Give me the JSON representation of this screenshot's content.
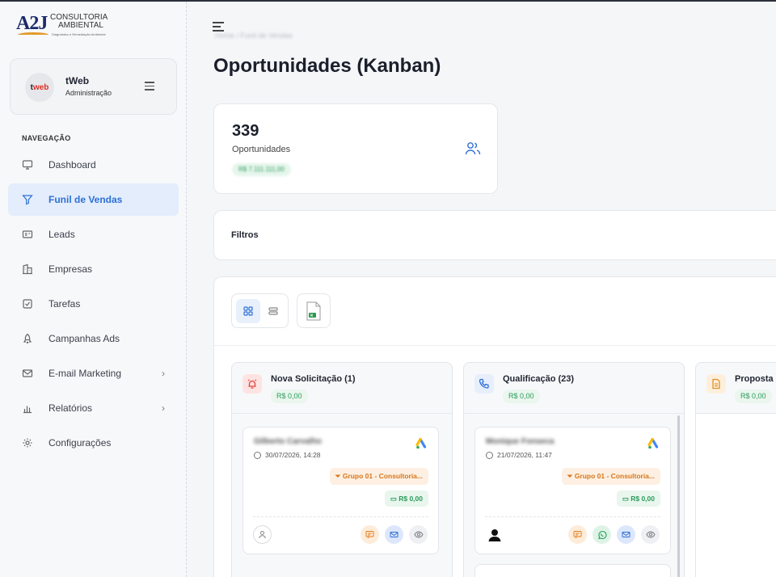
{
  "brand": {
    "mark": "A2J",
    "line1": "CONSULTORIA",
    "line2": "AMBIENTAL",
    "tagline": "Diagnóstico e Remediação Ambiental"
  },
  "profile": {
    "avatar_text_a": "t",
    "avatar_text_b": "web",
    "name": "tWeb",
    "role": "Administração"
  },
  "nav": {
    "heading": "NAVEGAÇÃO",
    "items": [
      {
        "label": "Dashboard",
        "icon": "monitor-icon"
      },
      {
        "label": "Funil de Vendas",
        "icon": "filter-icon",
        "active": true
      },
      {
        "label": "Leads",
        "icon": "id-card-icon"
      },
      {
        "label": "Empresas",
        "icon": "building-icon"
      },
      {
        "label": "Tarefas",
        "icon": "checkbox-icon"
      },
      {
        "label": "Campanhas Ads",
        "icon": "rocket-icon"
      },
      {
        "label": "E-mail Marketing",
        "icon": "envelope-icon",
        "has_submenu": true
      },
      {
        "label": "Relatórios",
        "icon": "bar-chart-icon",
        "has_submenu": true
      },
      {
        "label": "Configurações",
        "icon": "gear-icon"
      }
    ]
  },
  "header": {
    "breadcrumb": "Home  /  Funil de Vendas",
    "title": "Oportunidades (Kanban)"
  },
  "stat": {
    "count": "339",
    "label": "Oportunidades",
    "total": "R$ 7.111.111,00"
  },
  "filters": {
    "label": "Filtros"
  },
  "columns": [
    {
      "name": "Nova Solicitação (1)",
      "value": "R$ 0,00",
      "icon": "alarm-icon",
      "color": "#e2423b",
      "cards": [
        {
          "name": "Gilberto Carvalho",
          "date": "30/07/2026, 14:28",
          "group": "Grupo 01 - Consultoria...",
          "value": "R$ 0,00",
          "owner": "user-outline",
          "actions": [
            "chat",
            "mail",
            "view"
          ]
        }
      ]
    },
    {
      "name": "Qualificação (23)",
      "value": "R$ 0,00",
      "icon": "phone-icon",
      "color": "#2e6fd6",
      "cards": [
        {
          "name": "Monique Fonseca",
          "date": "21/07/2026, 11:47",
          "group": "Grupo 01 - Consultoria...",
          "value": "R$ 0,00",
          "owner": "user-filled",
          "actions": [
            "chat",
            "whatsapp",
            "mail",
            "view"
          ]
        }
      ]
    },
    {
      "name": "Proposta",
      "value": "R$ 0,00",
      "icon": "document-icon",
      "color": "#e0902a",
      "cards": []
    }
  ]
}
